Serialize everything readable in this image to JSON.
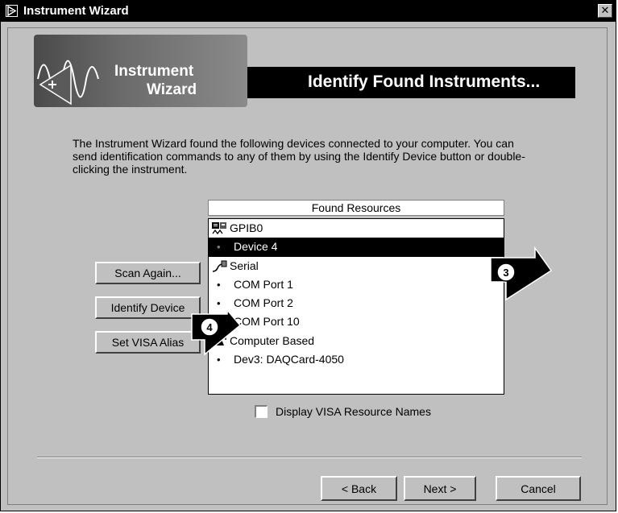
{
  "window": {
    "title": "Instrument Wizard"
  },
  "banner": {
    "logo_line1": "Instrument",
    "logo_line2": "Wizard",
    "heading": "Identify Found Instruments..."
  },
  "description": "The Instrument Wizard found the following devices connected to your computer.  You can send identification commands to any of them by using the Identify Device button or double-clicking the instrument.",
  "buttons": {
    "scan_again": "Scan Again...",
    "identify_device": "Identify Device",
    "set_visa_alias": "Set VISA Alias"
  },
  "found_resources": {
    "header": "Found Resources",
    "items": [
      {
        "label": "GPIB0",
        "type": "group",
        "icon": "gpib-icon"
      },
      {
        "label": "Device 4",
        "type": "child",
        "selected": true
      },
      {
        "label": "Serial",
        "type": "group",
        "icon": "serial-cable-icon"
      },
      {
        "label": "COM Port 1",
        "type": "child"
      },
      {
        "label": "COM Port 2",
        "type": "child"
      },
      {
        "label": "COM Port 10",
        "type": "child"
      },
      {
        "label": "Computer Based",
        "type": "group",
        "icon": "computer-based-icon"
      },
      {
        "label": "Dev3: DAQCard-4050",
        "type": "child"
      }
    ]
  },
  "display_visa_names": {
    "label": "Display VISA Resource Names",
    "checked": false
  },
  "nav": {
    "back": "< Back",
    "next": "Next >",
    "cancel": "Cancel"
  },
  "callouts": {
    "first": "3",
    "second": "4"
  }
}
